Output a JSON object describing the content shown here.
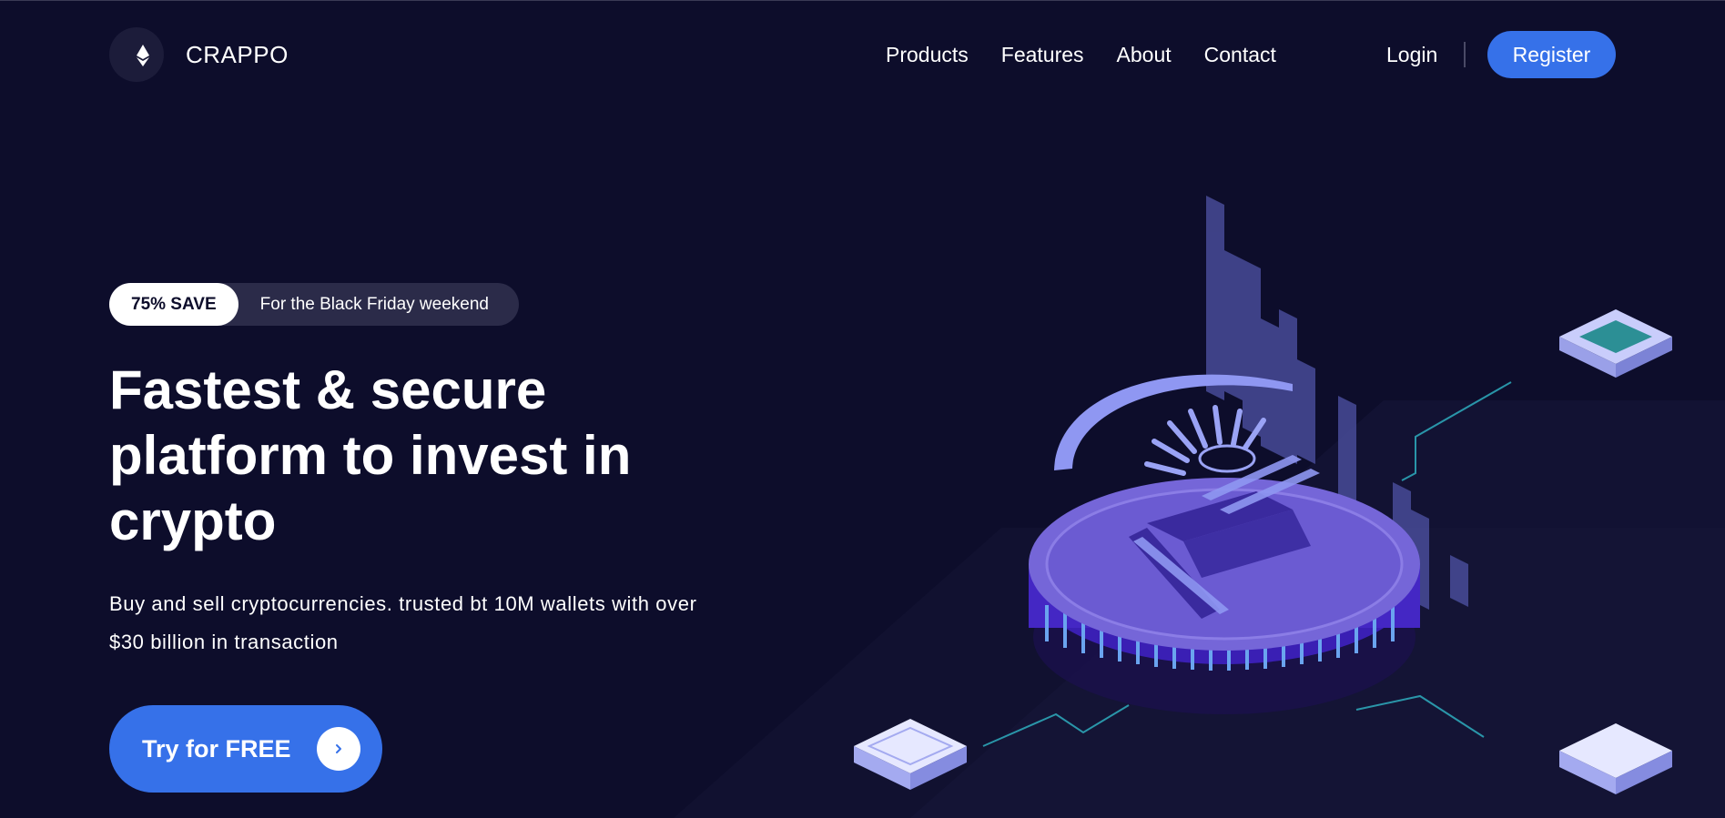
{
  "brand": {
    "name": "CRAPPO",
    "logo_icon": "crescent-ethereum-icon"
  },
  "nav": {
    "items": [
      {
        "label": "Products"
      },
      {
        "label": "Features"
      },
      {
        "label": "About"
      },
      {
        "label": "Contact"
      }
    ],
    "login_label": "Login",
    "register_label": "Register"
  },
  "hero": {
    "promo_badge": "75% SAVE",
    "promo_text": "For the Black Friday weekend",
    "headline": "Fastest & secure platform to invest in crypto",
    "subtext": "Buy and sell cryptocurrencies. trusted bt 10M wallets with over $30 billion in transaction",
    "cta_label": "Try for FREE",
    "cta_icon": "chevron-right-icon",
    "illustration_icon": "bitcoin-coin-icon"
  },
  "colors": {
    "background": "#0d0d2b",
    "accent": "#3671e9",
    "pill": "#2b2b49",
    "coin": "#7a6bd6"
  }
}
